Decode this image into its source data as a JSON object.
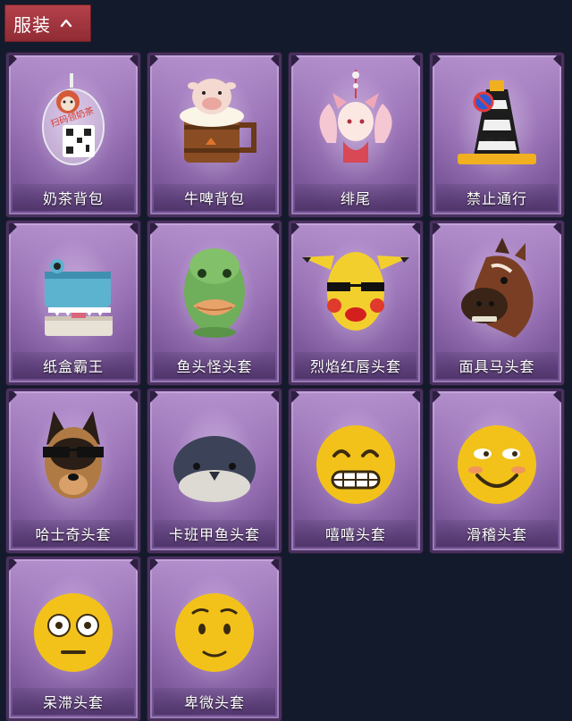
{
  "section": {
    "title": "服装",
    "expanded": true,
    "chevron_icon": "chevron-up-icon"
  },
  "items": [
    {
      "label": "奶茶背包",
      "icon": "milk-tea-backpack-icon",
      "art_text": "扫码领奶茶"
    },
    {
      "label": "牛啤背包",
      "icon": "cow-beer-mug-backpack-icon"
    },
    {
      "label": "绯尾",
      "icon": "fox-girl-pendant-icon"
    },
    {
      "label": "禁止通行",
      "icon": "no-entry-traffic-cone-icon"
    },
    {
      "label": "纸盒霸王",
      "icon": "cardboard-dinosaur-head-icon"
    },
    {
      "label": "鱼头怪头套",
      "icon": "fish-head-mask-icon"
    },
    {
      "label": "烈焰红唇头套",
      "icon": "pikachu-red-lips-mask-icon"
    },
    {
      "label": "面具马头套",
      "icon": "horse-head-mask-icon"
    },
    {
      "label": "哈士奇头套",
      "icon": "husky-sunglasses-mask-icon"
    },
    {
      "label": "卡班甲鱼头套",
      "icon": "seal-head-mask-icon"
    },
    {
      "label": "嘻嘻头套",
      "icon": "grinning-emoji-mask-icon"
    },
    {
      "label": "滑稽头套",
      "icon": "funny-emoji-mask-icon"
    },
    {
      "label": "呆滞头套",
      "icon": "flushed-emoji-mask-icon"
    },
    {
      "label": "卑微头套",
      "icon": "pleading-emoji-mask-icon"
    }
  ],
  "colors": {
    "background": "#121a2b",
    "header": "#a63a43",
    "card_frame": "#4a3160",
    "card_fill": "#9a76b8",
    "emoji_yellow": "#f2c21b"
  }
}
